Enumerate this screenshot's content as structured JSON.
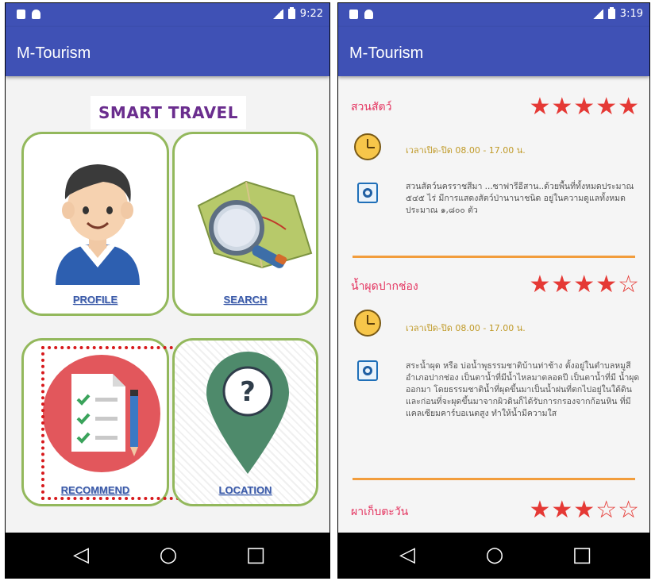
{
  "left": {
    "status_time": "9:22",
    "app_title": "M-Tourism",
    "banner": "SMART TRAVEL",
    "tiles": [
      {
        "label": "PROFILE"
      },
      {
        "label": "SEARCH"
      },
      {
        "label": "RECOMMEND"
      },
      {
        "label": "LOCATION"
      }
    ]
  },
  "right": {
    "status_time": "3:19",
    "app_title": "M-Tourism",
    "places": [
      {
        "name": "สวนสัตว์",
        "stars": "★★★★★",
        "rating": 5,
        "hours": "เวลาเปิด-ปิด 08.00 - 17.00 น.",
        "description": "สวนสัตว์นครราชสีมา ...ซาฟารีอีสาน..ด้วยพื้นที่ทั้งหมดประมาณ ๕๔๕ ไร่ มีการแสดงสัตว์ป่านานาชนิด อยู่ในความดูแลทั้งหมดประมาณ ๑,๘๐๐ ตัว"
      },
      {
        "name": "น้ำผุดปากช่อง",
        "stars": "★★★★☆",
        "rating": 4,
        "hours": "เวลาเปิด-ปิด 08.00 - 17.00 น.",
        "description": "สระน้ำผุด หรือ บ่อน้ำพุธรรมชาติบ้านท่าช้าง ตั้งอยู่ในตำบลหมูสี อำเภอปากช่อง เป็นตาน้ำที่มีน้ำไหลมาตลอดปี เป็นตาน้ำที่มี น้ำผุดออกมา โดยธรรมชาติน้ำที่ผุดขึ้นมาเป็นน้ำฝนที่ตกไปอยู่ในใต้ดินและก่อนที่จะผุดขึ้นมาจากผิวดินก็ได้รับการกรองจากก้อนหิน ที่มีแคลเซียมคาร์บอเนตสูง ทำให้น้ำมีความใส"
      },
      {
        "name": "ผาเก็บตะวัน",
        "stars": "★★★☆☆",
        "rating": 3
      }
    ]
  },
  "nav": {
    "back": "◁",
    "home": "○",
    "recent": "□"
  },
  "colors": {
    "primary": "#3f51b5",
    "tile_border": "#93b85c",
    "star": "#e53935",
    "place_name": "#e4335f",
    "divider": "#f29d3c",
    "highlight": "#d7191c"
  }
}
